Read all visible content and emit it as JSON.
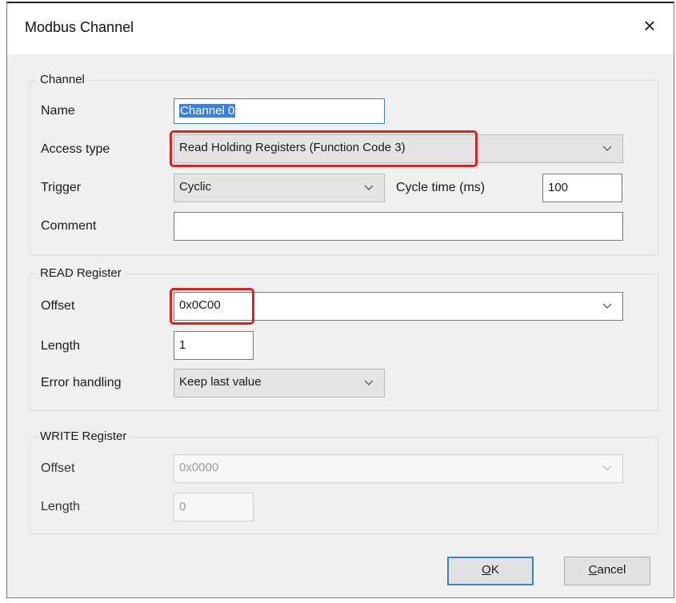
{
  "dialog": {
    "title": "Modbus Channel",
    "close_glyph": "×"
  },
  "channel": {
    "group_label": "Channel",
    "name_label": "Name",
    "name_value": "Channel 0",
    "access_type_label": "Access type",
    "access_type_value": "Read Holding Registers (Function Code 3)",
    "trigger_label": "Trigger",
    "trigger_value": "Cyclic",
    "cycle_time_label": "Cycle time (ms)",
    "cycle_time_value": "100",
    "comment_label": "Comment",
    "comment_value": ""
  },
  "read_register": {
    "group_label": "READ Register",
    "offset_label": "Offset",
    "offset_value": "0x0C00",
    "length_label": "Length",
    "length_value": "1",
    "error_handling_label": "Error handling",
    "error_handling_value": "Keep last value"
  },
  "write_register": {
    "group_label": "WRITE Register",
    "offset_label": "Offset",
    "offset_value": "0x0000",
    "length_label": "Length",
    "length_value": "0"
  },
  "buttons": {
    "ok_mnemonic": "O",
    "ok_rest": "K",
    "cancel_mnemonic": "C",
    "cancel_rest": "ancel"
  },
  "colors": {
    "highlight": "#e02020",
    "focus": "#3c7fd6"
  }
}
